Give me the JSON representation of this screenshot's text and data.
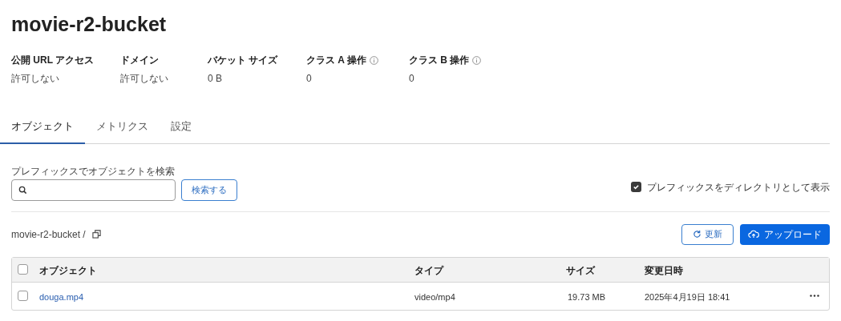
{
  "title": "movie-r2-bucket",
  "stats": [
    {
      "label": "公開 URL アクセス",
      "value": "許可しない",
      "info": false
    },
    {
      "label": "ドメイン",
      "value": "許可しない",
      "info": false
    },
    {
      "label": "バケット サイズ",
      "value": "0 B",
      "info": false
    },
    {
      "label": "クラス A 操作",
      "value": "0",
      "info": true
    },
    {
      "label": "クラス B 操作",
      "value": "0",
      "info": true
    }
  ],
  "tabs": [
    {
      "label": "オブジェクト",
      "selected": true
    },
    {
      "label": "メトリクス",
      "selected": false
    },
    {
      "label": "設定",
      "selected": false
    }
  ],
  "search": {
    "label": "プレフィックスでオブジェクトを検索",
    "button": "検索する"
  },
  "prefix_toggle": {
    "label": "プレフィックスをディレクトリとして表示",
    "checked": true
  },
  "breadcrumb": "movie-r2-bucket /",
  "refresh_button": "更新",
  "upload_button": "アップロード",
  "table": {
    "all_checked": false,
    "columns": [
      "オブジェクト",
      "タイプ",
      "サイズ",
      "変更日時"
    ],
    "rows": [
      {
        "checked": false,
        "cells": [
          "douga.mp4",
          "video/mp4",
          "19.73 MB",
          "2025年4月19日 18:41"
        ]
      }
    ]
  }
}
